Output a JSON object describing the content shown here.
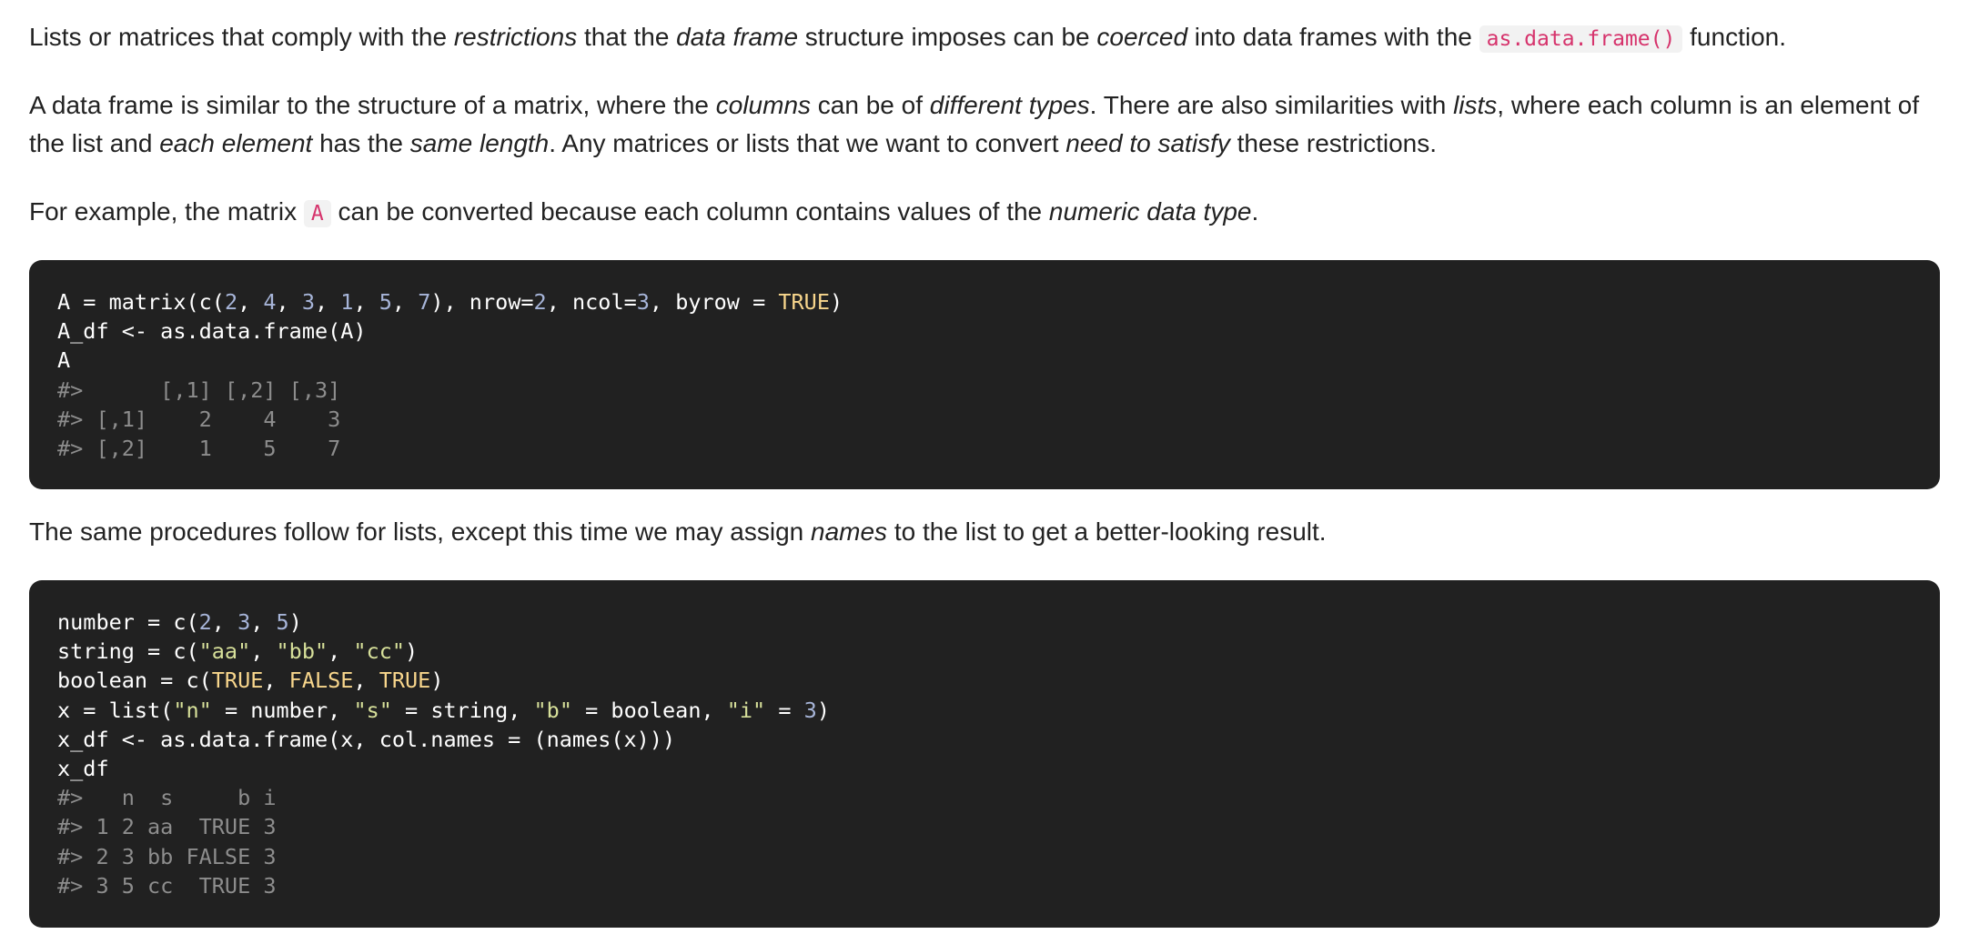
{
  "paragraphs": {
    "p1": {
      "t1": "Lists or matrices that comply with the ",
      "e1": "restrictions",
      "t2": " that the ",
      "e2": "data frame",
      "t3": " structure imposes can be ",
      "e3": "coerced",
      "t4": " into data frames with the ",
      "code": "as.data.frame()",
      "t5": " function."
    },
    "p2": {
      "t1": "A data frame is similar to the structure of a matrix, where the ",
      "e1": "columns",
      "t2": " can be of ",
      "e2": "different types",
      "t3": ". There are also similarities with ",
      "e3": "lists",
      "t4": ", where each column is an element of the list and ",
      "e4": "each element",
      "t5": " has the ",
      "e5": "same length",
      "t6": ". Any matrices or lists that we want to convert ",
      "e6": "need to satisfy",
      "t7": " these restrictions."
    },
    "p3": {
      "t1": "For example, the matrix ",
      "code": "A",
      "t2": " can be converted because each column contains values of the ",
      "e1": "numeric data type",
      "t3": "."
    },
    "p4": {
      "t1": "The same procedures follow for lists, except this time we may assign ",
      "e1": "names",
      "t2": " to the list to get a better-looking result."
    }
  },
  "code_block_1": {
    "line1": {
      "a": "A = matrix(c(",
      "n1": "2",
      "s1": ", ",
      "n2": "4",
      "s2": ", ",
      "n3": "3",
      "s3": ", ",
      "n4": "1",
      "s4": ", ",
      "n5": "5",
      "s5": ", ",
      "n6": "7",
      "b": "), nrow=",
      "n7": "2",
      "c": ", ncol=",
      "n8": "3",
      "d": ", byrow = ",
      "kw": "TRUE",
      "e": ")"
    },
    "line2": "A_df <- as.data.frame(A)",
    "line3": "A",
    "output": [
      "#>      [,1] [,2] [,3]",
      "#> [,1]    2    4    3",
      "#> [,2]    1    5    7"
    ]
  },
  "code_block_2": {
    "line1": {
      "a": "number = c(",
      "n1": "2",
      "s1": ", ",
      "n2": "3",
      "s2": ", ",
      "n3": "5",
      "b": ")"
    },
    "line2": {
      "a": "string = c(",
      "str1": "\"aa\"",
      "s1": ", ",
      "str2": "\"bb\"",
      "s2": ", ",
      "str3": "\"cc\"",
      "b": ")"
    },
    "line3": {
      "a": "boolean = c(",
      "kw1": "TRUE",
      "s1": ", ",
      "kw2": "FALSE",
      "s2": ", ",
      "kw3": "TRUE",
      "b": ")"
    },
    "line4": {
      "a": "x = list(",
      "str1": "\"n\"",
      "b": " = number, ",
      "str2": "\"s\"",
      "c": " = string, ",
      "str3": "\"b\"",
      "d": " = boolean, ",
      "str4": "\"i\"",
      "e": " = ",
      "n1": "3",
      "f": ")"
    },
    "line5": "x_df <- as.data.frame(x, col.names = (names(x)))",
    "line6": "x_df",
    "output": [
      "#>   n  s     b i",
      "#> 1 2 aa  TRUE 3",
      "#> 2 3 bb FALSE 3",
      "#> 3 5 cc  TRUE 3"
    ]
  },
  "colors": {
    "code_background": "#212121",
    "number": "#a7b5d9",
    "string": "#d7e09a",
    "keyword": "#f8d68c",
    "output": "#8d8d8d",
    "inline_code": "#d6336c"
  }
}
